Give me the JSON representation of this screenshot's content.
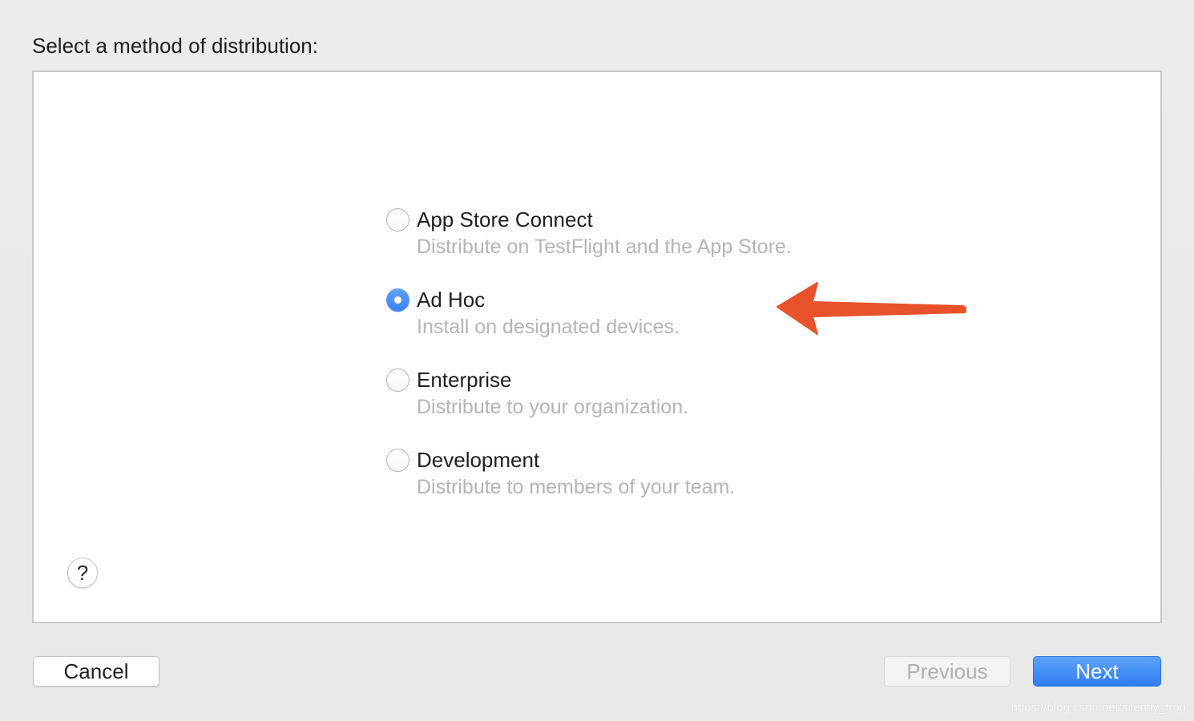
{
  "heading": "Select a method of distribution:",
  "options": [
    {
      "title": "App Store Connect",
      "description": "Distribute on TestFlight and the App Store.",
      "selected": false
    },
    {
      "title": "Ad Hoc",
      "description": "Install on designated devices.",
      "selected": true
    },
    {
      "title": "Enterprise",
      "description": "Distribute to your organization.",
      "selected": false
    },
    {
      "title": "Development",
      "description": "Distribute to members of your team.",
      "selected": false
    }
  ],
  "help": {
    "label": "?"
  },
  "buttons": {
    "cancel": "Cancel",
    "previous": "Previous",
    "next": "Next"
  },
  "annotation": {
    "icon": "arrow-left-icon",
    "color": "#e8522a"
  },
  "colors": {
    "accent": "#3a82f6"
  },
  "watermark": "https://blog.csdn.net/silently_frog"
}
